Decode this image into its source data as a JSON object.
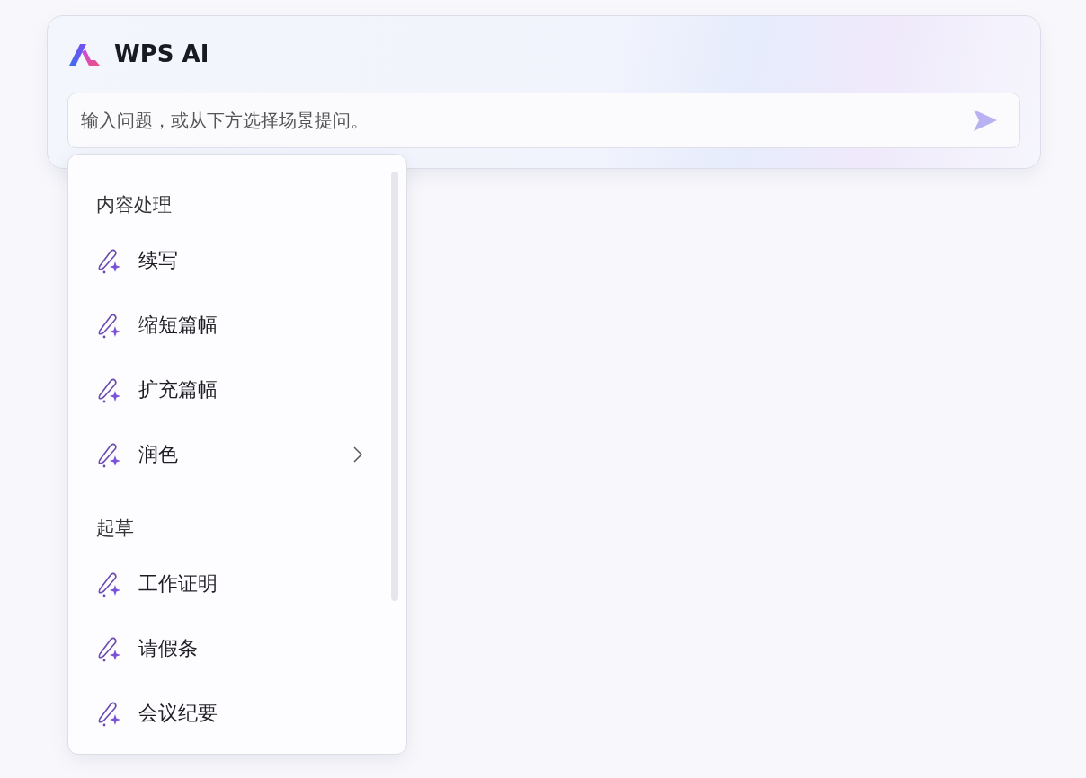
{
  "header": {
    "title": "WPS AI"
  },
  "input": {
    "placeholder": "输入问题，或从下方选择场景提问。"
  },
  "menu": {
    "sections": [
      {
        "title": "内容处理",
        "items": [
          {
            "label": "续写",
            "submenu": false
          },
          {
            "label": "缩短篇幅",
            "submenu": false
          },
          {
            "label": "扩充篇幅",
            "submenu": false
          },
          {
            "label": "润色",
            "submenu": true
          }
        ]
      },
      {
        "title": "起草",
        "items": [
          {
            "label": "工作证明",
            "submenu": false
          },
          {
            "label": "请假条",
            "submenu": false
          },
          {
            "label": "会议纪要",
            "submenu": false
          }
        ]
      }
    ]
  }
}
